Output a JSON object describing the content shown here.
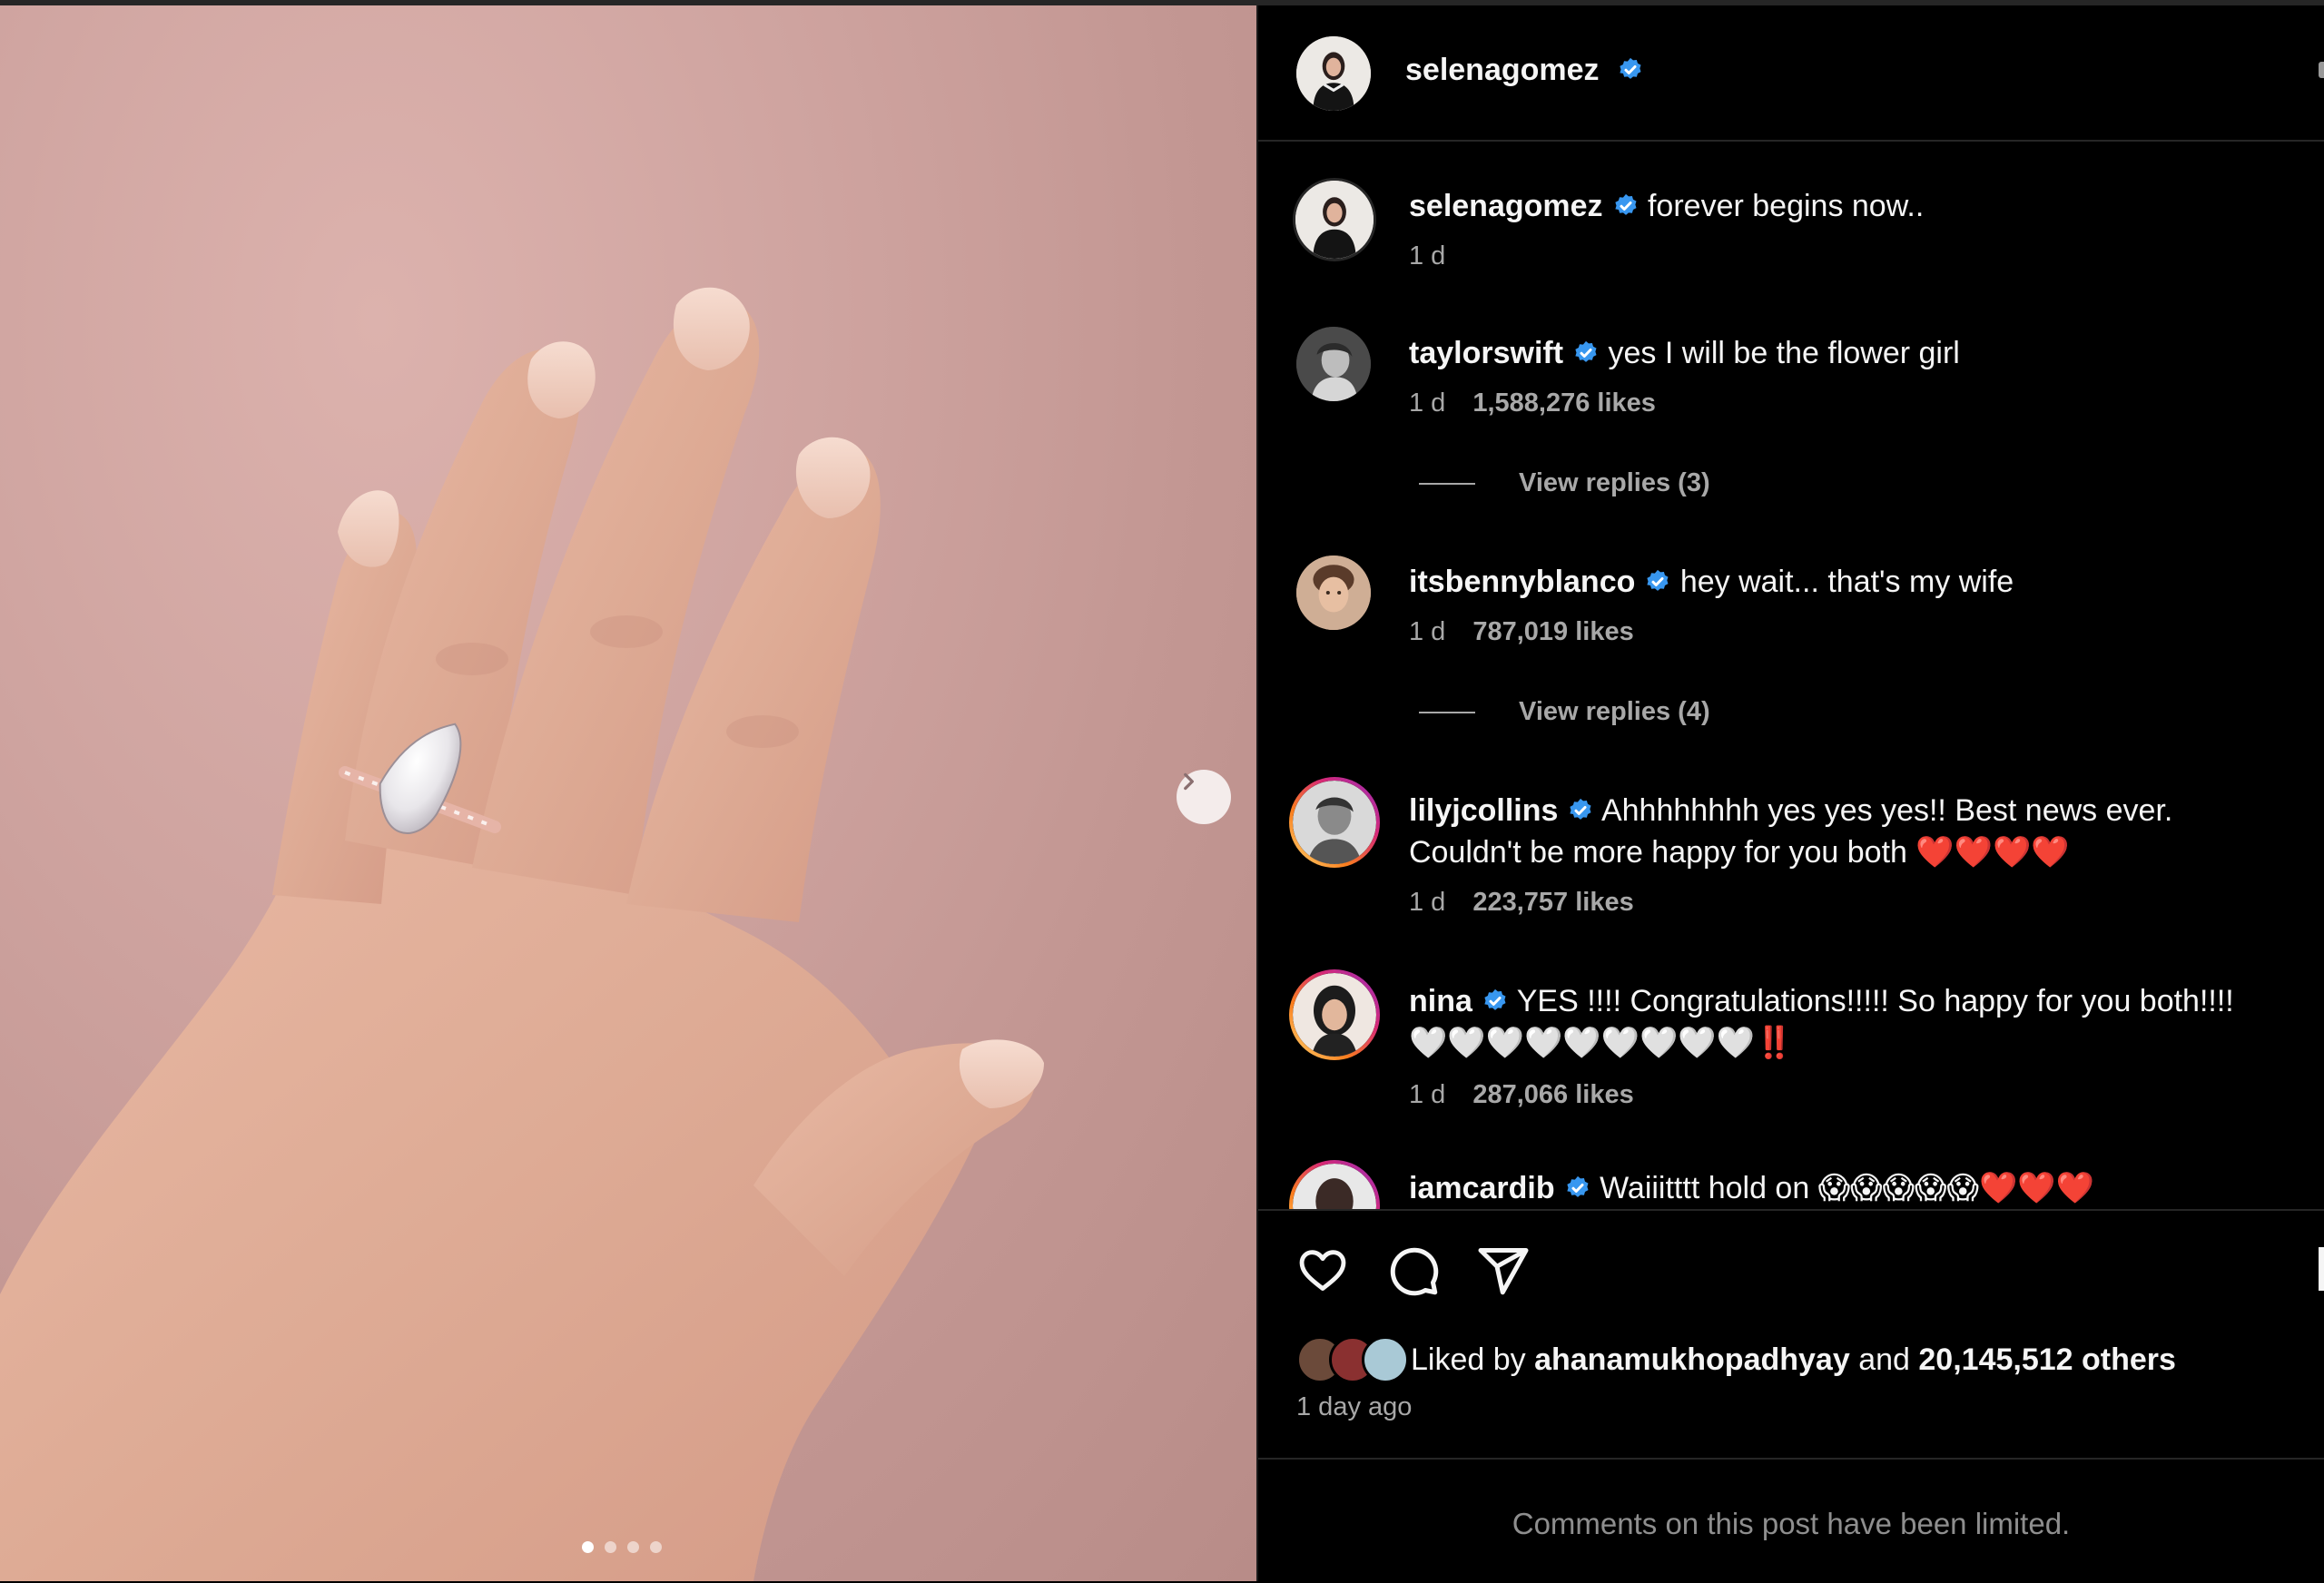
{
  "post": {
    "author": "selenagomez",
    "caption": "forever begins now..",
    "caption_age": "1 d",
    "carousel": {
      "slides": 4,
      "active": 1
    }
  },
  "comments": [
    {
      "user": "taylorswift",
      "text": "yes I will be the flower girl",
      "age": "1 d",
      "likes": "1,588,276 likes",
      "replies": "View replies (3)"
    },
    {
      "user": "itsbennyblanco",
      "text": "hey wait... that's my wife",
      "age": "1 d",
      "likes": "787,019 likes",
      "replies": "View replies (4)"
    },
    {
      "user": "lilyjcollins",
      "text_line1": "Ahhhhhhhh yes yes yes!! Best news ever.",
      "text_line2": "Couldn't be more happy for you both",
      "emoji": "❤️❤️❤️❤️",
      "age": "1 d",
      "likes": "223,757 likes"
    },
    {
      "user": "nina",
      "text_line1": "YES !!!! Congratulations!!!!! So happy for you both!!!!",
      "emoji_line2": "🤍🤍🤍🤍🤍🤍🤍🤍🤍",
      "emoji_line2_end": "‼️",
      "age": "1 d",
      "likes": "287,066 likes"
    },
    {
      "user": "iamcardib",
      "text": "Waiiitttt hold on",
      "emoji": "😱😱😱😱😱❤️❤️❤️"
    }
  ],
  "liked": {
    "prefix": "Liked by",
    "user": "ahanamukhopadhyay",
    "and": "and",
    "others": "20,145,512 others"
  },
  "time_ago": "1 day ago",
  "limited_notice": "Comments on this post have been limited.",
  "icons": [
    "chevron-right-icon",
    "heart-icon",
    "comment-icon",
    "share-icon",
    "verified-badge-icon"
  ],
  "colors": {
    "verified": "#3897f0",
    "bg": "#000000",
    "muted": "#a8a8a8"
  }
}
